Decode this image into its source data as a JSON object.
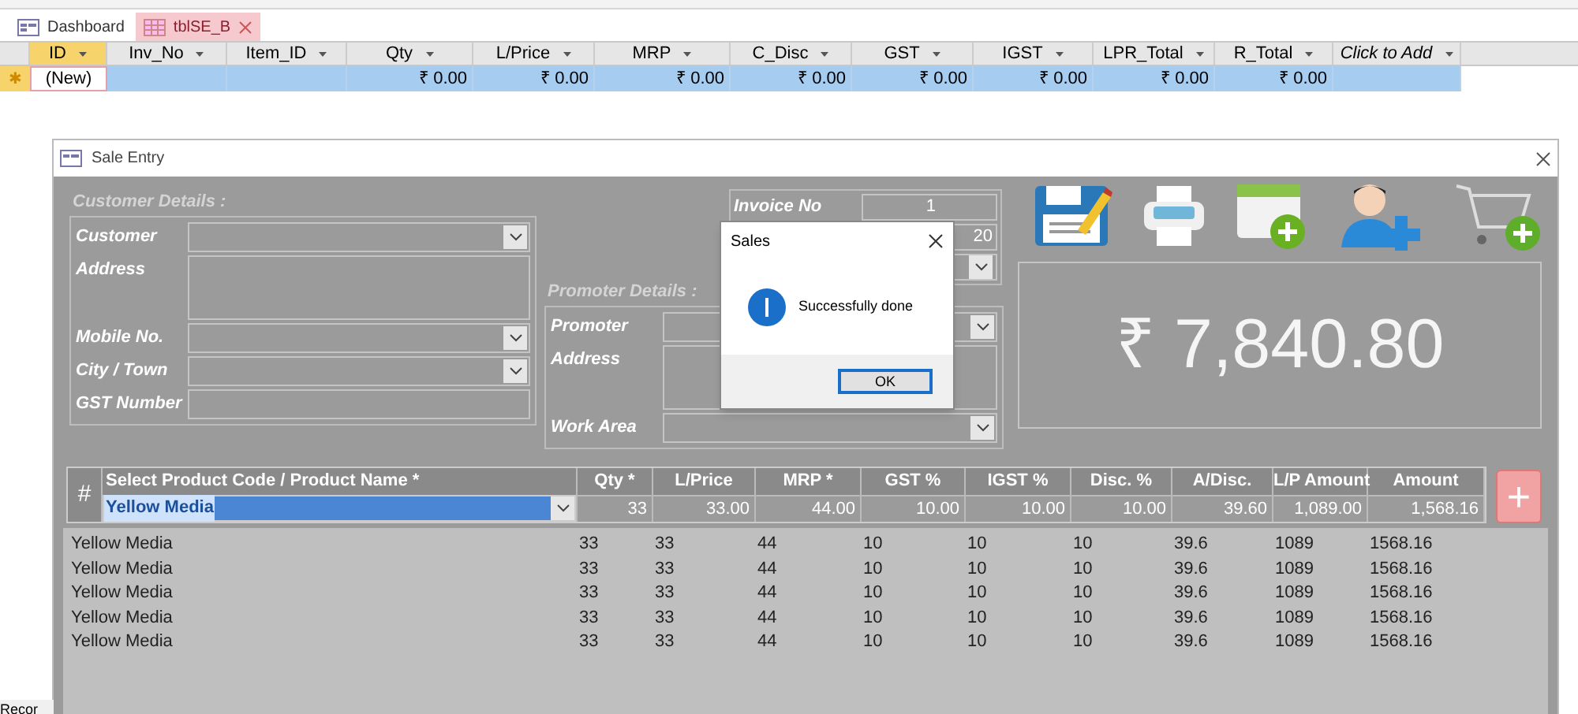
{
  "document_tabs": [
    {
      "label": "Dashboard",
      "kind": "form",
      "selected": false
    },
    {
      "label": "tblSE_B",
      "kind": "table",
      "selected": true
    }
  ],
  "datasheet": {
    "columns": [
      {
        "label": "ID",
        "kind": "field",
        "selected": true
      },
      {
        "label": "Inv_No",
        "kind": "field",
        "selected": false
      },
      {
        "label": "Item_ID",
        "kind": "field",
        "selected": false
      },
      {
        "label": "Qty",
        "kind": "field",
        "selected": false
      },
      {
        "label": "L/Price",
        "kind": "field",
        "selected": false
      },
      {
        "label": "MRP",
        "kind": "field",
        "selected": false
      },
      {
        "label": "C_Disc",
        "kind": "field",
        "selected": false
      },
      {
        "label": "GST",
        "kind": "field",
        "selected": false
      },
      {
        "label": "IGST",
        "kind": "field",
        "selected": false
      },
      {
        "label": "LPR_Total",
        "kind": "field",
        "selected": false
      },
      {
        "label": "R_Total",
        "kind": "field",
        "selected": false
      },
      {
        "label": "Click to Add",
        "kind": "add",
        "selected": false
      }
    ],
    "new_row": {
      "marker": "✱",
      "cells": [
        "(New)",
        "",
        "",
        "₹ 0.00",
        "₹ 0.00",
        "₹ 0.00",
        "₹ 0.00",
        "₹ 0.00",
        "₹ 0.00",
        "₹ 0.00",
        "₹ 0.00",
        ""
      ]
    }
  },
  "form": {
    "title": "Sale Entry",
    "customer": {
      "title": "Customer Details :",
      "fields": [
        {
          "label": "Customer",
          "kind": "combo"
        },
        {
          "label": "Address",
          "kind": "memo"
        },
        {
          "label": "Mobile No.",
          "kind": "combo"
        },
        {
          "label": "City / Town",
          "kind": "combo"
        },
        {
          "label": "GST Number",
          "kind": "text"
        }
      ]
    },
    "invoice": {
      "fields": [
        {
          "label": "Invoice No",
          "value": "1",
          "kind": "text"
        },
        {
          "value": "20",
          "kind": "text"
        },
        {
          "kind": "combo"
        }
      ]
    },
    "promoter": {
      "title": "Promoter Details :",
      "fields": [
        {
          "label": "Promoter",
          "kind": "combo"
        },
        {
          "label": "Address",
          "kind": "memo"
        },
        {
          "label": "Work Area",
          "kind": "combo"
        }
      ]
    },
    "total": "₹ 7,840.80",
    "entry": {
      "hash": "#",
      "columns": [
        "Select Product Code / Product Name *",
        "Qty *",
        "L/Price",
        "MRP *",
        "GST %",
        "IGST %",
        "Disc. %",
        "A/Disc.",
        "L/P Amount",
        "Amount"
      ],
      "values": [
        "Yellow Media",
        "33",
        "33.00",
        "44.00",
        "10.00",
        "10.00",
        "10.00",
        "39.60",
        "1,089.00",
        "1,568.16"
      ],
      "product_selected": true,
      "add_label": "+"
    },
    "lines": [
      [
        "Yellow Media",
        "33",
        "33",
        "44",
        "10",
        "10",
        "10",
        "39.6",
        "1089",
        "1568.16"
      ],
      [
        "Yellow Media",
        "33",
        "33",
        "44",
        "10",
        "10",
        "10",
        "39.6",
        "1089",
        "1568.16"
      ],
      [
        "Yellow Media",
        "33",
        "33",
        "44",
        "10",
        "10",
        "10",
        "39.6",
        "1089",
        "1568.16"
      ],
      [
        "Yellow Media",
        "33",
        "33",
        "44",
        "10",
        "10",
        "10",
        "39.6",
        "1089",
        "1568.16"
      ],
      [
        "Yellow Media",
        "33",
        "33",
        "44",
        "10",
        "10",
        "10",
        "39.6",
        "1089",
        "1568.16"
      ]
    ]
  },
  "dialog": {
    "title": "Sales",
    "message": "Successfully done",
    "button": "OK"
  },
  "status_bar": "Recor"
}
